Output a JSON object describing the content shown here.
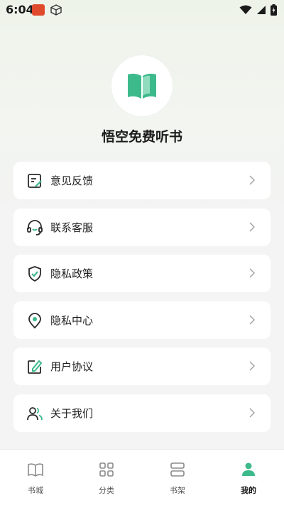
{
  "status_bar": {
    "time": "6:04"
  },
  "app": {
    "name": "悟空免费听书",
    "accent": "#3dba8c"
  },
  "menu": {
    "items": [
      {
        "label": "意见反馈",
        "icon": "feedback-icon"
      },
      {
        "label": "联系客服",
        "icon": "headset-icon"
      },
      {
        "label": "隐私政策",
        "icon": "shield-check-icon"
      },
      {
        "label": "隐私中心",
        "icon": "location-pin-icon"
      },
      {
        "label": "用户协议",
        "icon": "edit-document-icon"
      },
      {
        "label": "关于我们",
        "icon": "users-icon"
      }
    ]
  },
  "tabs": [
    {
      "label": "书城",
      "icon": "open-book-icon",
      "active": false
    },
    {
      "label": "分类",
      "icon": "grid-icon",
      "active": false
    },
    {
      "label": "书架",
      "icon": "shelf-icon",
      "active": false
    },
    {
      "label": "我的",
      "icon": "person-icon",
      "active": true
    }
  ]
}
